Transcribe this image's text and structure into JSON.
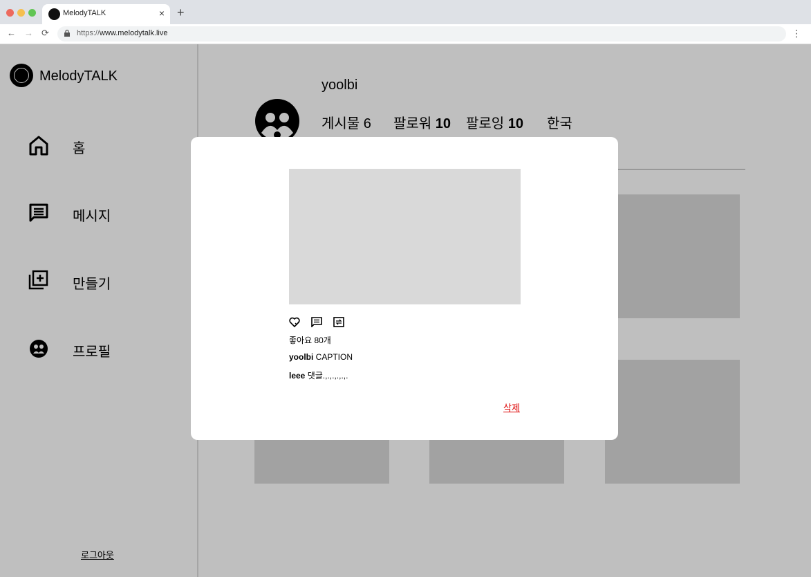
{
  "browser": {
    "tab_title": "MelodyTALK",
    "url_prefix": "https://",
    "url_host": "www.melodytalk.live",
    "new_tab": "+",
    "close": "×"
  },
  "sidebar": {
    "brand": "MelodyTALK",
    "items": [
      {
        "label": "홈",
        "icon": "home-icon"
      },
      {
        "label": "메시지",
        "icon": "message-icon"
      },
      {
        "label": "만들기",
        "icon": "add-box-icon"
      },
      {
        "label": "프로필",
        "icon": "profile-icon"
      }
    ],
    "logout": "로그아웃"
  },
  "profile": {
    "username": "yoolbi",
    "posts_label": "게시물",
    "posts_count": "6",
    "followers_label": "팔로워",
    "followers_count": "10",
    "following_label": "팔로잉",
    "following_count": "10",
    "region": "한국"
  },
  "modal": {
    "likes": "좋아요 80개",
    "caption_user": "yoolbi",
    "caption_text": " CAPTION",
    "comment_user": "leee",
    "comment_text": " 댓글.,.,.,.,.,.",
    "delete": "삭제"
  },
  "colors": {
    "overlay": "#00000040",
    "delete": "#dd0000",
    "placeholder": "#d9d9d9"
  }
}
